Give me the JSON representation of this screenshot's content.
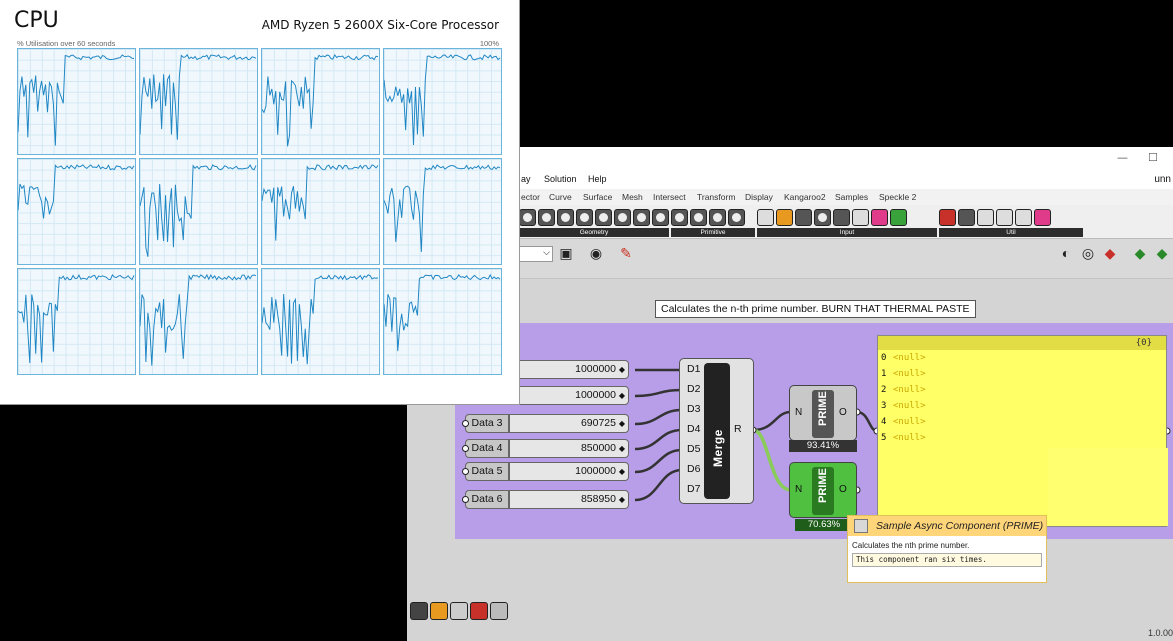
{
  "task_manager": {
    "title": "CPU",
    "processor": "AMD Ryzen 5 2600X Six-Core Processor",
    "subtitle": "% Utilisation over 60 seconds",
    "max_label": "100%",
    "core_count": 12
  },
  "grasshopper": {
    "window_controls": {
      "minimize": "—",
      "maximize": "☐"
    },
    "doc_title": "unn",
    "menu": [
      "ay",
      "Solution",
      "Help"
    ],
    "tabs": [
      "ector",
      "Curve",
      "Surface",
      "Mesh",
      "Intersect",
      "Transform",
      "Display",
      "Kangaroo2",
      "Samples",
      "Speckle 2"
    ],
    "ribbon_groups": [
      "Geometry",
      "Primitive",
      "Input",
      "Util"
    ],
    "tooltip_bubble": "Calculates the n-th prime number. BURN THAT THERMAL PASTE",
    "sliders": [
      {
        "label": "",
        "value": "1000000"
      },
      {
        "label": "",
        "value": "1000000"
      },
      {
        "label": "Data 3",
        "value": "690725"
      },
      {
        "label": "Data 4",
        "value": "850000"
      },
      {
        "label": "Data 5",
        "value": "1000000"
      },
      {
        "label": "Data 6",
        "value": "858950"
      }
    ],
    "merge": {
      "title": "Merge",
      "inputs": [
        "D1",
        "D2",
        "D3",
        "D4",
        "D5",
        "D6",
        "D7"
      ],
      "output": "R"
    },
    "prime_components": [
      {
        "title": "PRIME",
        "input": "N",
        "output": "O",
        "progress": "93.41%",
        "state": "grey"
      },
      {
        "title": "PRIME",
        "input": "N",
        "output": "O",
        "progress": "70.63%",
        "state": "green"
      }
    ],
    "panel": {
      "header": "{0}",
      "rows": [
        {
          "index": "0",
          "value": "<null>"
        },
        {
          "index": "1",
          "value": "<null>"
        },
        {
          "index": "2",
          "value": "<null>"
        },
        {
          "index": "3",
          "value": "<null>"
        },
        {
          "index": "4",
          "value": "<null>"
        },
        {
          "index": "5",
          "value": "<null>"
        }
      ]
    },
    "tooltip": {
      "title": "Sample Async Component (PRIME)",
      "description": "Calculates the nth prime number.",
      "note": "This component ran six times."
    },
    "version": "1.0.00"
  }
}
